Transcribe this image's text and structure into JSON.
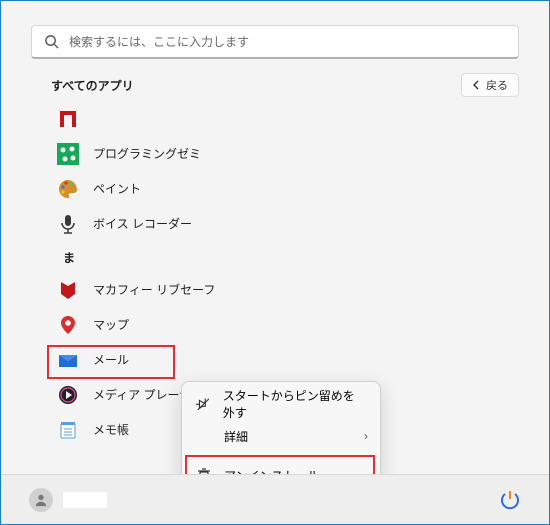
{
  "search": {
    "placeholder": "検索するには、ここに入力します"
  },
  "section_title": "すべてのアプリ",
  "back_label": "戻る",
  "apps": [
    {
      "label": ""
    },
    {
      "label": "プログラミングゼミ"
    },
    {
      "label": "ペイント"
    },
    {
      "label": "ボイス レコーダー"
    }
  ],
  "section_letter": "ま",
  "apps2": [
    {
      "label": "マカフィー リブセーフ"
    },
    {
      "label": "マップ"
    },
    {
      "label": "メール"
    },
    {
      "label": "メディア プレーヤー"
    },
    {
      "label": "メモ帳"
    }
  ],
  "context_menu": {
    "unpin": "スタートからピン留めを外す",
    "details": "詳細",
    "uninstall": "アンインストール"
  }
}
